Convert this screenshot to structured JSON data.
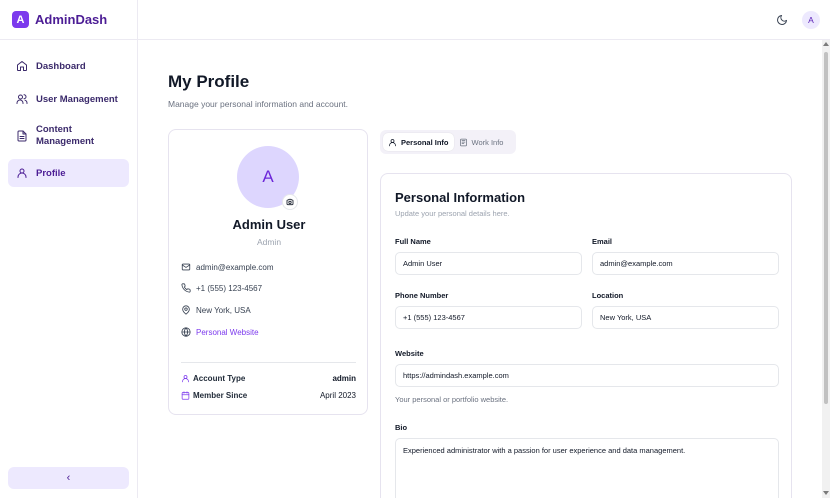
{
  "brand": {
    "logo_letter": "A",
    "name": "AdminDash"
  },
  "sidebar": {
    "items": [
      {
        "label": "Dashboard",
        "icon": "home-icon"
      },
      {
        "label": "User Management",
        "icon": "users-icon"
      },
      {
        "label": "Content Management",
        "icon": "file-icon"
      },
      {
        "label": "Profile",
        "icon": "user-icon",
        "active": true
      }
    ],
    "collapse_label": "‹"
  },
  "header": {
    "avatar_letter": "A",
    "theme_icon": "moon-icon"
  },
  "page": {
    "title": "My Profile",
    "subtitle": "Manage your personal information and account."
  },
  "profile": {
    "avatar_letter": "A",
    "name": "Admin User",
    "role": "Admin",
    "email": "admin@example.com",
    "phone": "+1 (555) 123-4567",
    "location": "New York, USA",
    "website_label": "Personal Website",
    "account_type_label": "Account Type",
    "account_type_value": "admin",
    "member_since_label": "Member Since",
    "member_since_value": "April 2023"
  },
  "tabs": [
    {
      "label": "Personal Info",
      "icon": "user-icon",
      "active": true
    },
    {
      "label": "Work Info",
      "icon": "briefcase-icon",
      "active": false
    }
  ],
  "form": {
    "title": "Personal Information",
    "subtitle": "Update your personal details here.",
    "full_name_label": "Full Name",
    "full_name_value": "Admin User",
    "email_label": "Email",
    "email_value": "admin@example.com",
    "phone_label": "Phone Number",
    "phone_value": "+1 (555) 123-4567",
    "location_label": "Location",
    "location_value": "New York, USA",
    "website_label": "Website",
    "website_value": "https://admindash.example.com",
    "website_help": "Your personal or portfolio website.",
    "bio_label": "Bio",
    "bio_value": "Experienced administrator with a passion for user experience and data management."
  },
  "colors": {
    "accent": "#7c3aed",
    "accent_soft": "#ede9fe",
    "brand_text": "#4c1d95"
  }
}
